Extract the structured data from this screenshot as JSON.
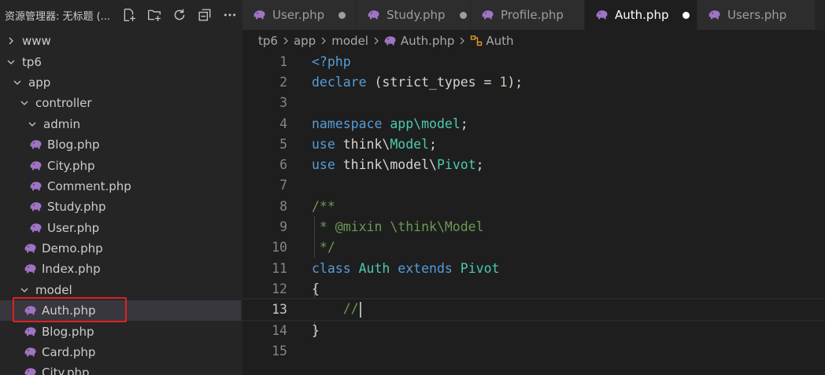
{
  "explorer": {
    "title": "资源管理器: 无标题 (...",
    "actions": [
      {
        "name": "new-file-icon"
      },
      {
        "name": "new-folder-icon"
      },
      {
        "name": "refresh-icon"
      },
      {
        "name": "collapse-all-icon"
      },
      {
        "name": "more-icon"
      }
    ],
    "tree": [
      {
        "label": "www",
        "kind": "folder",
        "expanded": false,
        "depth": 0
      },
      {
        "label": "tp6",
        "kind": "folder",
        "expanded": true,
        "depth": 0
      },
      {
        "label": "app",
        "kind": "folder",
        "expanded": true,
        "depth": 1
      },
      {
        "label": "controller",
        "kind": "folder",
        "expanded": true,
        "depth": 2
      },
      {
        "label": "admin",
        "kind": "folder",
        "expanded": true,
        "depth": 3
      },
      {
        "label": "Blog.php",
        "kind": "php",
        "depth": 4
      },
      {
        "label": "City.php",
        "kind": "php",
        "depth": 4
      },
      {
        "label": "Comment.php",
        "kind": "php",
        "depth": 4
      },
      {
        "label": "Study.php",
        "kind": "php",
        "depth": 4
      },
      {
        "label": "User.php",
        "kind": "php",
        "depth": 4
      },
      {
        "label": "Demo.php",
        "kind": "php",
        "depth": 3
      },
      {
        "label": "Index.php",
        "kind": "php",
        "depth": 3
      },
      {
        "label": "model",
        "kind": "folder",
        "expanded": true,
        "depth": 2
      },
      {
        "label": "Auth.php",
        "kind": "php",
        "depth": 3,
        "selected": true
      },
      {
        "label": "Blog.php",
        "kind": "php",
        "depth": 3
      },
      {
        "label": "Card.php",
        "kind": "php",
        "depth": 3
      },
      {
        "label": "City.php",
        "kind": "php",
        "depth": 3
      }
    ]
  },
  "tabs": [
    {
      "label": "User.php",
      "modified": true,
      "active": false
    },
    {
      "label": "Study.php",
      "modified": true,
      "active": false
    },
    {
      "label": "Profile.php",
      "modified": false,
      "active": false
    },
    {
      "label": "Auth.php",
      "modified": true,
      "active": true
    },
    {
      "label": "Users.php",
      "modified": false,
      "active": false
    }
  ],
  "breadcrumb": {
    "segments": [
      "tp6",
      "app",
      "model",
      "Auth.php",
      "Auth"
    ]
  },
  "editor": {
    "current_line": 13,
    "lines": [
      {
        "n": "1",
        "tokens": [
          {
            "t": "<?php",
            "c": "kw"
          }
        ]
      },
      {
        "n": "2",
        "tokens": [
          {
            "t": "declare",
            "c": "kw"
          },
          {
            "t": " (strict_types = ",
            "c": "plain"
          },
          {
            "t": "1",
            "c": "num"
          },
          {
            "t": ");",
            "c": "plain"
          }
        ]
      },
      {
        "n": "3",
        "tokens": []
      },
      {
        "n": "4",
        "tokens": [
          {
            "t": "namespace",
            "c": "kw"
          },
          {
            "t": " ",
            "c": "plain"
          },
          {
            "t": "app\\model",
            "c": "type"
          },
          {
            "t": ";",
            "c": "plain"
          }
        ]
      },
      {
        "n": "5",
        "tokens": [
          {
            "t": "use",
            "c": "kw"
          },
          {
            "t": " think\\",
            "c": "plain"
          },
          {
            "t": "Model",
            "c": "type"
          },
          {
            "t": ";",
            "c": "plain"
          }
        ]
      },
      {
        "n": "6",
        "tokens": [
          {
            "t": "use",
            "c": "kw"
          },
          {
            "t": " think\\model\\",
            "c": "plain"
          },
          {
            "t": "Pivot",
            "c": "type"
          },
          {
            "t": ";",
            "c": "plain"
          }
        ]
      },
      {
        "n": "7",
        "tokens": []
      },
      {
        "n": "8",
        "tokens": [
          {
            "t": "/**",
            "c": "cm"
          }
        ]
      },
      {
        "n": "9",
        "tokens": [
          {
            "t": " * @mixin \\think\\Model",
            "c": "cm"
          }
        ]
      },
      {
        "n": "10",
        "tokens": [
          {
            "t": " */",
            "c": "cm"
          }
        ]
      },
      {
        "n": "11",
        "tokens": [
          {
            "t": "class",
            "c": "kw"
          },
          {
            "t": " ",
            "c": "plain"
          },
          {
            "t": "Auth",
            "c": "type"
          },
          {
            "t": " ",
            "c": "plain"
          },
          {
            "t": "extends",
            "c": "kw"
          },
          {
            "t": " ",
            "c": "plain"
          },
          {
            "t": "Pivot",
            "c": "type"
          }
        ]
      },
      {
        "n": "12",
        "tokens": [
          {
            "t": "{",
            "c": "plain"
          }
        ]
      },
      {
        "n": "13",
        "tokens": [
          {
            "t": "    //",
            "c": "cm"
          }
        ],
        "cursor": true
      },
      {
        "n": "14",
        "tokens": [
          {
            "t": "}",
            "c": "plain"
          }
        ]
      },
      {
        "n": "15",
        "tokens": []
      }
    ]
  },
  "colors": {
    "php_icon": "#a074c4",
    "highlight_box": "#e02020",
    "keyword": "#569cd6",
    "type": "#4ec9b0",
    "comment": "#6a9955",
    "number": "#b5cea8"
  }
}
